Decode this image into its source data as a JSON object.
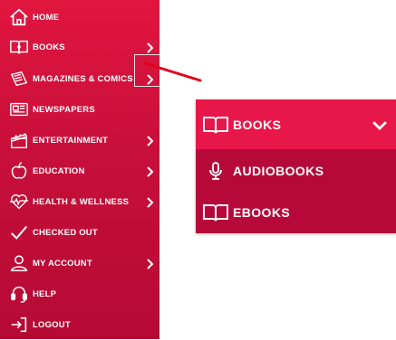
{
  "sidebar": {
    "items": [
      {
        "label": "HOME",
        "icon": "home-icon",
        "has_submenu": false
      },
      {
        "label": "BOOKS",
        "icon": "book-icon",
        "has_submenu": true
      },
      {
        "label": "MAGAZINES & COMICS",
        "icon": "magazine-icon",
        "has_submenu": true
      },
      {
        "label": "NEWSPAPERS",
        "icon": "newspaper-icon",
        "has_submenu": false
      },
      {
        "label": "ENTERTAINMENT",
        "icon": "clapperboard-icon",
        "has_submenu": true
      },
      {
        "label": "EDUCATION",
        "icon": "apple-icon",
        "has_submenu": true
      },
      {
        "label": "HEALTH & WELLNESS",
        "icon": "heartbeat-icon",
        "has_submenu": true
      },
      {
        "label": "CHECKED OUT",
        "icon": "checkmark-icon",
        "has_submenu": false
      },
      {
        "label": "MY ACCOUNT",
        "icon": "user-icon",
        "has_submenu": true
      },
      {
        "label": "HELP",
        "icon": "headset-icon",
        "has_submenu": false
      },
      {
        "label": "LOGOUT",
        "icon": "logout-icon",
        "has_submenu": false
      }
    ]
  },
  "expanded_panel": {
    "title": "BOOKS",
    "title_icon": "book-icon",
    "toggle_icon": "chevron-down-icon",
    "items": [
      {
        "label": "AUDIOBOOKS",
        "icon": "microphone-icon"
      },
      {
        "label": "EBOOKS",
        "icon": "book-icon"
      }
    ]
  },
  "colors": {
    "sidebar_top": "#e1163f",
    "sidebar_bottom": "#b50a34",
    "panel_header": "#e8174a",
    "panel_body": "#b6093a",
    "annotation_arrow": "#e0001b"
  }
}
